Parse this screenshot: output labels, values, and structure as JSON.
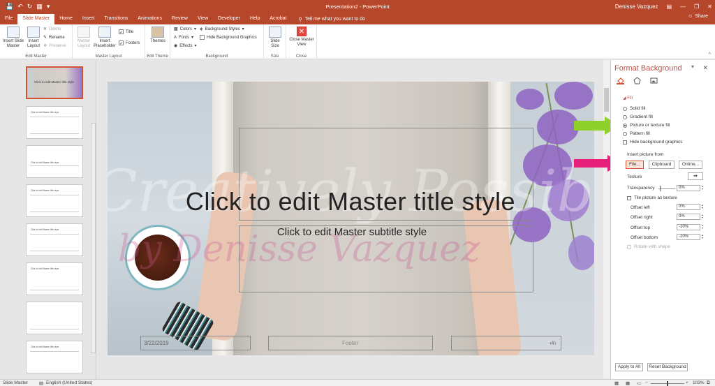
{
  "app": {
    "window_title": "Presentation2 - PowerPoint",
    "user": "Denisse Vazquez",
    "share": "Share",
    "tell_me": "Tell me what you want to do"
  },
  "tabs": [
    "File",
    "Slide Master",
    "Home",
    "Insert",
    "Transitions",
    "Animations",
    "Review",
    "View",
    "Developer",
    "Help",
    "Acrobat"
  ],
  "active_tab": "Slide Master",
  "ribbon": {
    "edit_master": {
      "label": "Edit Master",
      "insert_slide_master": "Insert Slide Master",
      "insert_layout": "Insert Layout",
      "delete": "Delete",
      "rename": "Rename",
      "preserve": "Preserve"
    },
    "master_layout": {
      "label": "Master Layout",
      "master_layout_btn": "Master Layout",
      "insert_placeholder": "Insert Placeholder",
      "title": "Title",
      "footers": "Footers"
    },
    "edit_theme": {
      "label": "Edit Theme",
      "themes": "Themes"
    },
    "background": {
      "label": "Background",
      "colors": "Colors",
      "fonts": "Fonts",
      "effects": "Effects",
      "background_styles": "Background Styles",
      "hide_bg_graphics": "Hide Background Graphics"
    },
    "size": {
      "label": "Size",
      "slide_size": "Slide Size"
    },
    "close": {
      "label": "Close",
      "close_master_view": "Close Master View"
    }
  },
  "thumbnails": [
    {
      "title": "Click to edit Master title style"
    },
    {
      "title": "Click to edit Master title style"
    },
    {
      "title": "Click to edit Master title style"
    },
    {
      "title": "Click to edit Master title style"
    },
    {
      "title": "Click to edit Master title style"
    },
    {
      "title": "Click to edit Master title style"
    },
    {
      "title": ""
    },
    {
      "title": "Click to edit Master title style"
    }
  ],
  "slide": {
    "title": "Click to edit Master title style",
    "subtitle": "Click to edit Master subtitle style",
    "date": "3/22/2019",
    "footer": "Footer",
    "page_num": "‹#›",
    "watermark_line1": "Creatively Possible",
    "watermark_line2": "by Denisse Vazquez"
  },
  "format_pane": {
    "title": "Format Background",
    "fill_header": "Fill",
    "options": {
      "solid": "Solid fill",
      "gradient": "Gradient fill",
      "picture": "Picture or texture fill",
      "pattern": "Pattern fill"
    },
    "selected_option": "picture",
    "hide_bg_graphics": "Hide background graphics",
    "insert_from": "Insert picture from",
    "file_btn": "File...",
    "clipboard_btn": "Clipboard",
    "online_btn": "Online...",
    "texture": "Texture",
    "transparency": "Transparency",
    "transparency_val": "0%",
    "tile": "Tile picture as texture",
    "offset_left": "Offset left",
    "offset_left_val": "0%",
    "offset_right": "Offset right",
    "offset_right_val": "0%",
    "offset_top": "Offset top",
    "offset_top_val": "-10%",
    "offset_bottom": "Offset bottom",
    "offset_bottom_val": "-10%",
    "rotate": "Rotate with shape",
    "apply_all": "Apply to All",
    "reset": "Reset Background"
  },
  "status": {
    "view": "Slide Master",
    "language": "English (United States)",
    "zoom": "103%"
  },
  "colors": {
    "accent": "#b7472a",
    "arrow_green": "#8fd12a",
    "arrow_pink": "#e6207a"
  }
}
